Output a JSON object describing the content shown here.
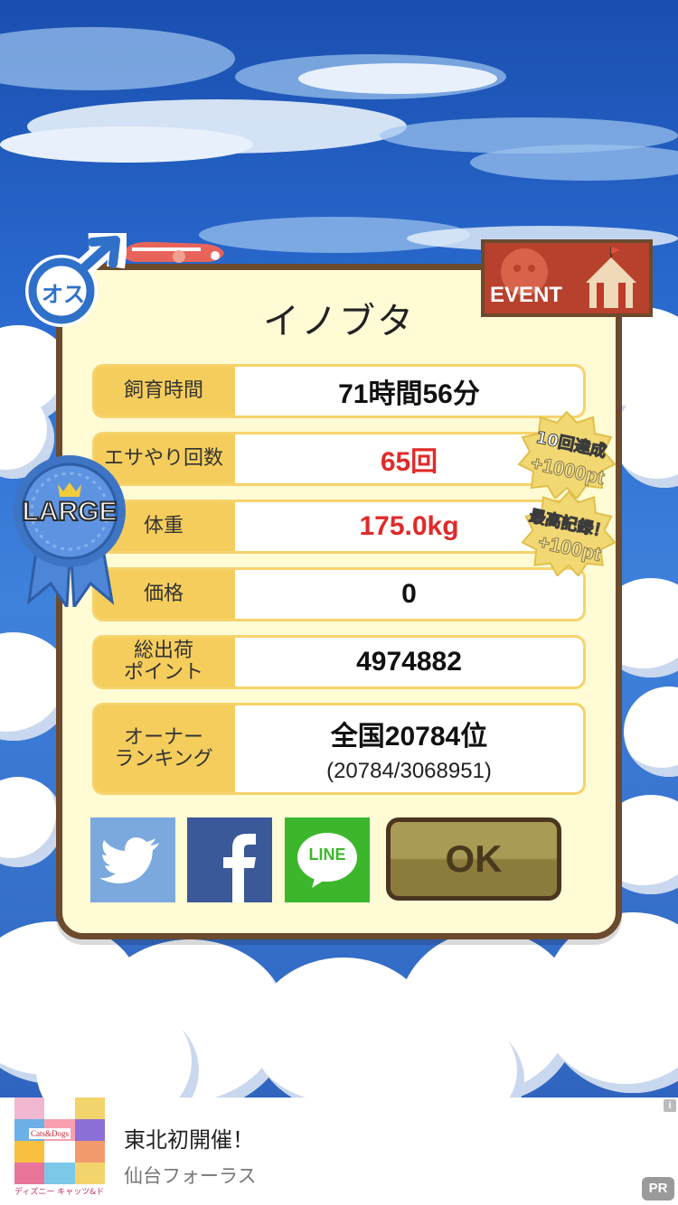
{
  "animal": {
    "name": "イノブタ",
    "gender_badge": "オス",
    "size_badge": "LARGE",
    "event_label": "EVENT"
  },
  "stats": [
    {
      "label": "飼育時間",
      "value": "71時間56分"
    },
    {
      "label": "エサやり回数",
      "value": "65回"
    },
    {
      "label": "体重",
      "value": "175.0kg"
    },
    {
      "label": "価格",
      "value": "0"
    },
    {
      "label": "総出荷\nポイント",
      "value": "4974882"
    },
    {
      "label": "オーナー\nランキング",
      "value": "全国20784位",
      "sub": "(20784/3068951)"
    }
  ],
  "bonuses": [
    {
      "line1": "10回達成",
      "line2": "+1000pt"
    },
    {
      "line1": "最高記録！",
      "line2": "+100pt"
    }
  ],
  "buttons": {
    "ok": "OK",
    "line": "LINE",
    "twitter_icon": "twitter-icon",
    "facebook_icon": "facebook-icon"
  },
  "ad": {
    "title": "東北初開催！",
    "subtitle": "仙台フォーラス",
    "thumb_caption": "ディズニー キャッツ&ドッグス展",
    "thumb_logo": "Cats&Dogs",
    "info": "i",
    "pr": "PR"
  },
  "colors": {
    "card_bg": "#fefbd5",
    "card_border": "#6b4a2d",
    "label_bg": "#f4cd5c",
    "highlight_red": "#e02a2a",
    "twitter": "#7ba9de",
    "facebook": "#3b5998",
    "line": "#3cb72c",
    "ok_button": "#a99a55"
  }
}
